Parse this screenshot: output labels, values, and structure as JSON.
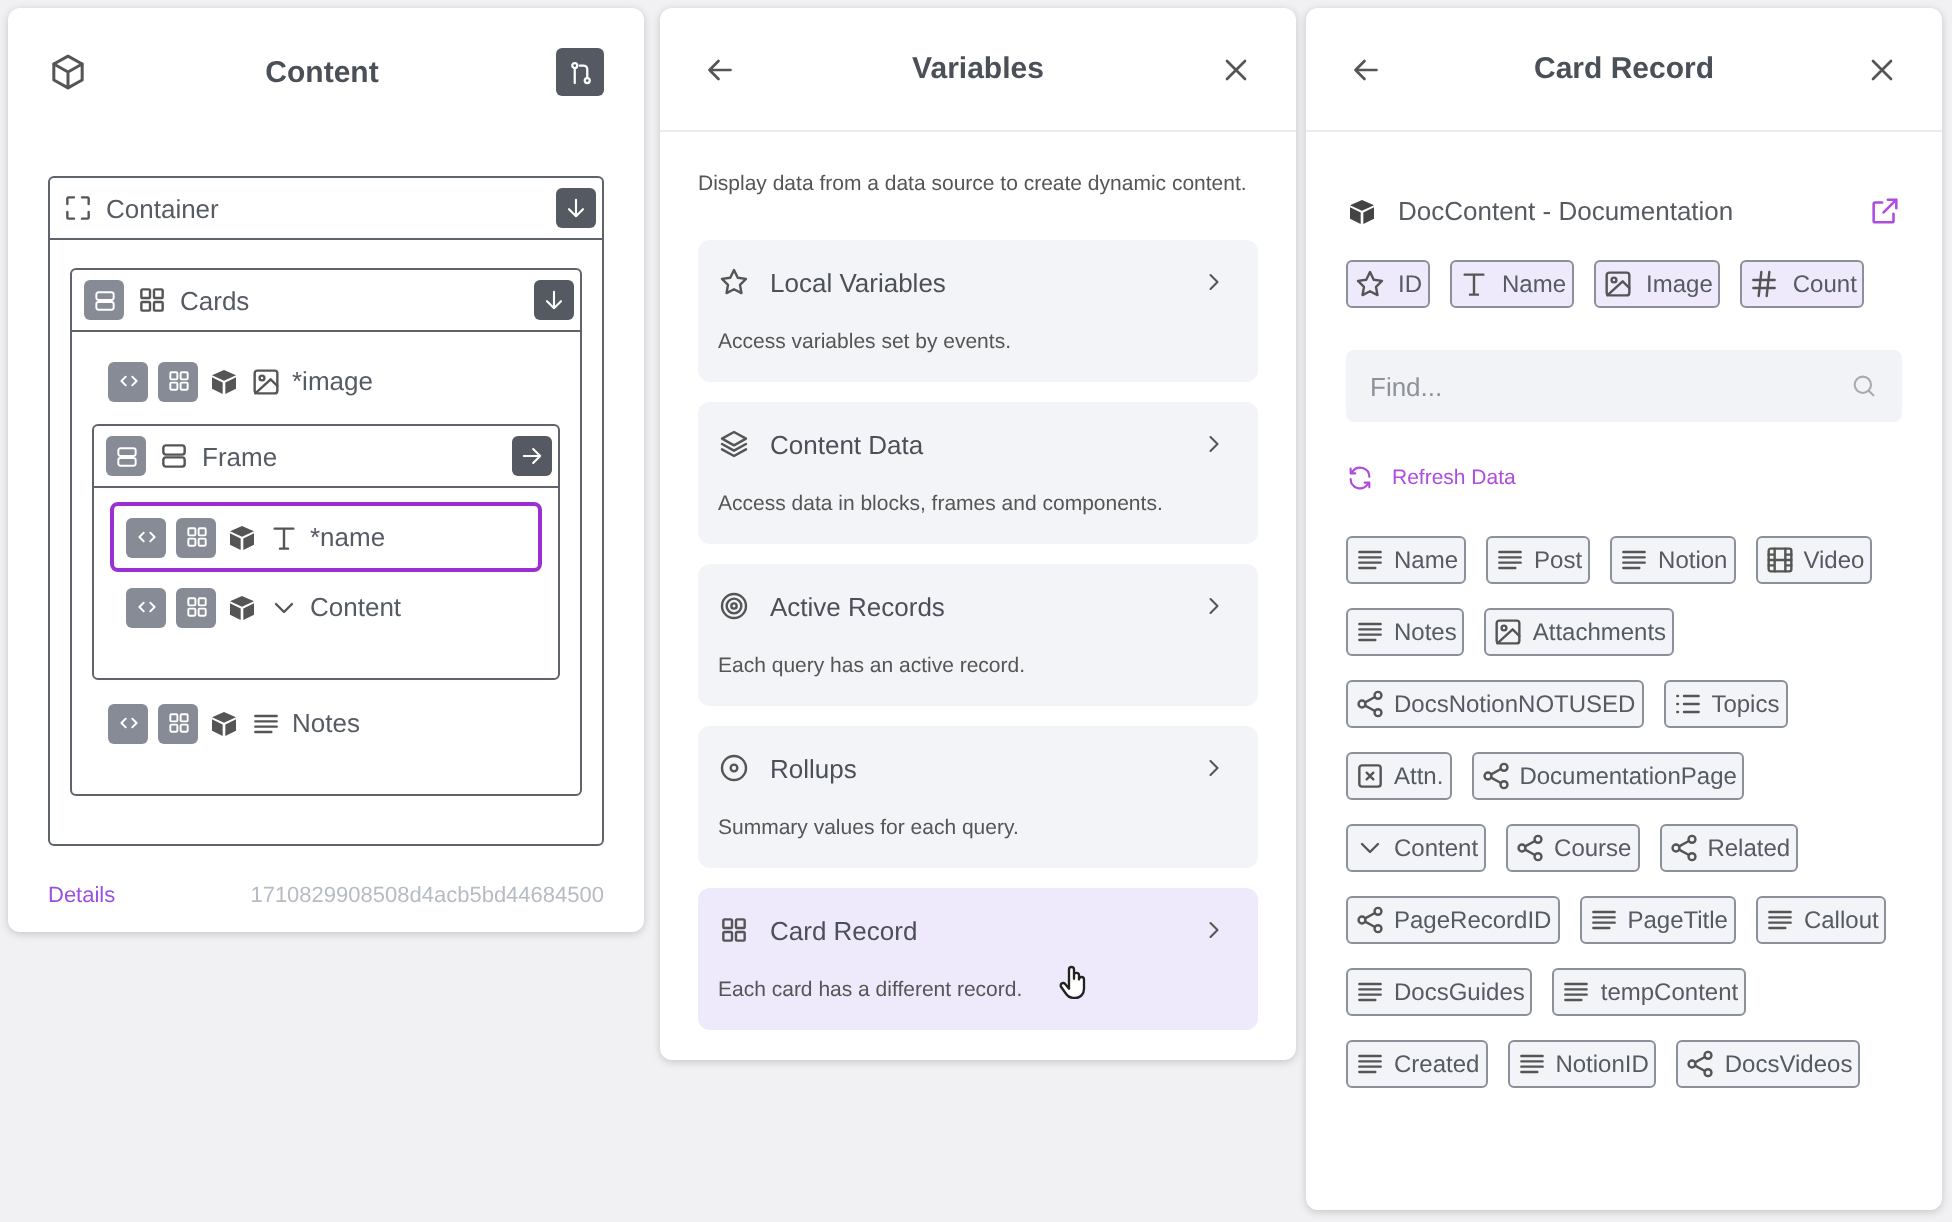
{
  "content_panel": {
    "title": "Content",
    "tree": {
      "kind": "container",
      "label": "Container",
      "children": [
        {
          "kind": "list",
          "label": "Cards",
          "children": [
            {
              "kind": "image",
              "label": "*image",
              "selected": false
            },
            {
              "kind": "frame",
              "label": "Frame",
              "children": [
                {
                  "kind": "text",
                  "label": "*name",
                  "selected": true
                },
                {
                  "kind": "select",
                  "label": "Content",
                  "selected": false
                }
              ]
            },
            {
              "kind": "rich_text",
              "label": "Notes",
              "selected": false
            }
          ]
        }
      ]
    },
    "footer_link": "Details",
    "record_id": "1710829908508d4acb5bd44684500"
  },
  "variables_panel": {
    "title": "Variables",
    "description": "Display data from a data source to create dynamic content.",
    "items": [
      {
        "kind": "local",
        "title": "Local Variables",
        "description": "Access variables set by events.",
        "selected": false
      },
      {
        "kind": "content",
        "title": "Content Data",
        "description": "Access data in blocks, frames and components.",
        "selected": false
      },
      {
        "kind": "active",
        "title": "Active Records",
        "description": "Each query has an active record.",
        "selected": false
      },
      {
        "kind": "rollup",
        "title": "Rollups",
        "description": "Summary values for each query.",
        "selected": false
      },
      {
        "kind": "card",
        "title": "Card Record",
        "description": "Each card has a different record.",
        "selected": true
      }
    ]
  },
  "record_panel": {
    "title": "Card Record",
    "source": "DocContent - Documentation",
    "pinned": [
      {
        "kind": "id",
        "label": "ID"
      },
      {
        "kind": "text",
        "label": "Name"
      },
      {
        "kind": "image",
        "label": "Image"
      },
      {
        "kind": "number",
        "label": "Count"
      }
    ],
    "search": {
      "placeholder": "Find..."
    },
    "refresh": "Refresh Data",
    "fields": [
      {
        "kind": "text",
        "label": "Name"
      },
      {
        "kind": "text",
        "label": "Post"
      },
      {
        "kind": "text",
        "label": "Notion"
      },
      {
        "kind": "video",
        "label": "Video"
      },
      {
        "kind": "text",
        "label": "Notes"
      },
      {
        "kind": "image",
        "label": "Attachments"
      },
      {
        "kind": "relation",
        "label": "DocsNotionNOTUSED"
      },
      {
        "kind": "list",
        "label": "Topics"
      },
      {
        "kind": "formula",
        "label": "Attn."
      },
      {
        "kind": "relation",
        "label": "DocumentationPage"
      },
      {
        "kind": "select",
        "label": "Content"
      },
      {
        "kind": "relation",
        "label": "Course"
      },
      {
        "kind": "relation",
        "label": "Related"
      },
      {
        "kind": "relation",
        "label": "PageRecordID"
      },
      {
        "kind": "text",
        "label": "PageTitle"
      },
      {
        "kind": "text",
        "label": "Callout"
      },
      {
        "kind": "text",
        "label": "DocsGuides"
      },
      {
        "kind": "text",
        "label": "tempContent"
      },
      {
        "kind": "text",
        "label": "Created"
      },
      {
        "kind": "text",
        "label": "NotionID"
      },
      {
        "kind": "relation",
        "label": "DocsVideos"
      }
    ]
  }
}
